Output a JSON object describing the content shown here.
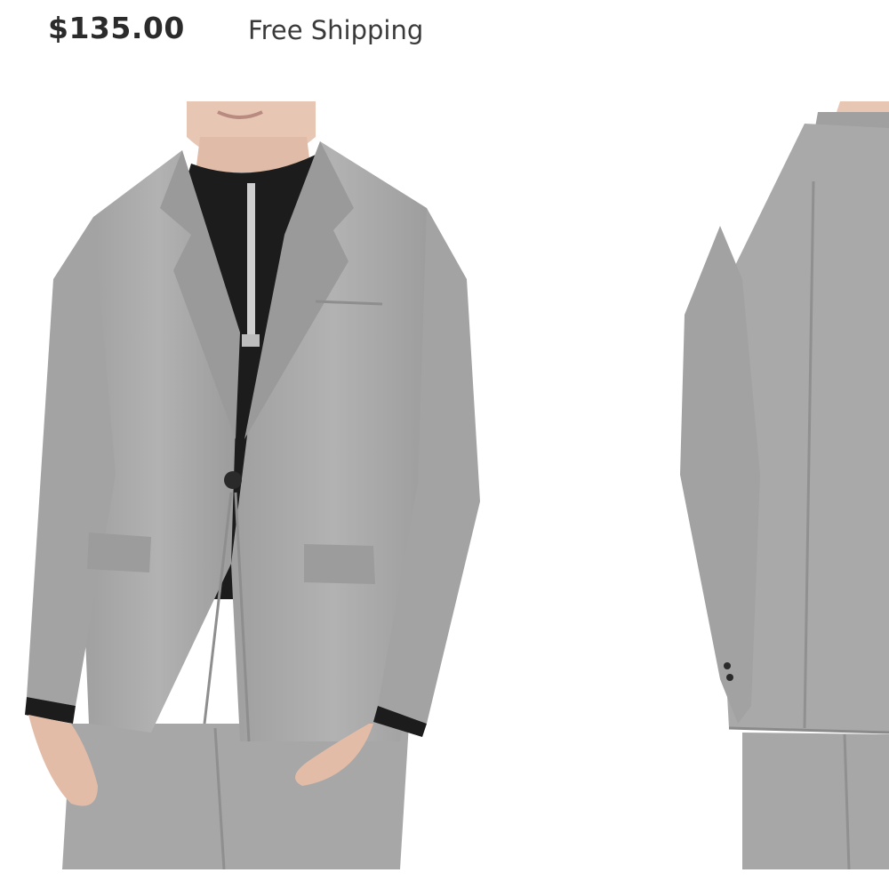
{
  "product": {
    "price": "$135.00",
    "shipping": "Free Shipping"
  },
  "gallery": {
    "images": [
      {
        "view": "front"
      },
      {
        "view": "back"
      }
    ]
  },
  "colors": {
    "suit": "#a9a9a9",
    "suit_shadow": "#8e8e8e",
    "shirt": "#1c1c1c",
    "skin": "#e7c6b4",
    "price_text": "#2b2b2b",
    "shipping_text": "#3a3a3a"
  }
}
